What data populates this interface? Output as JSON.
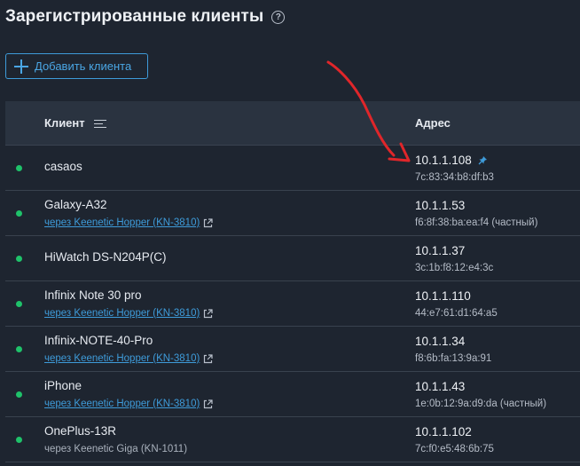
{
  "page": {
    "title": "Зарегистрированные клиенты",
    "help_icon": "?",
    "add_button_label": "Добавить клиента"
  },
  "table": {
    "headers": {
      "client": "Клиент",
      "address": "Адрес"
    },
    "rows": [
      {
        "name": "casaos",
        "via": "",
        "via_link": false,
        "ip": "10.1.1.108",
        "mac": "7c:83:34:b8:df:b3",
        "pinned": true,
        "status": "online"
      },
      {
        "name": "Galaxy-A32",
        "via": "через Keenetic Hopper (KN-3810)",
        "via_link": true,
        "ip": "10.1.1.53",
        "mac": "f6:8f:38:ba:ea:f4 (частный)",
        "pinned": false,
        "status": "online"
      },
      {
        "name": "HiWatch DS-N204P(C)",
        "via": "",
        "via_link": false,
        "ip": "10.1.1.37",
        "mac": "3c:1b:f8:12:e4:3c",
        "pinned": false,
        "status": "online"
      },
      {
        "name": "Infinix Note 30 pro",
        "via": "через Keenetic Hopper (KN-3810)",
        "via_link": true,
        "ip": "10.1.1.110",
        "mac": "44:e7:61:d1:64:a5",
        "pinned": false,
        "status": "online"
      },
      {
        "name": "Infinix-NOTE-40-Pro",
        "via": "через Keenetic Hopper (KN-3810)",
        "via_link": true,
        "ip": "10.1.1.34",
        "mac": "f8:6b:fa:13:9a:91",
        "pinned": false,
        "status": "online"
      },
      {
        "name": "iPhone",
        "via": "через Keenetic Hopper (KN-3810)",
        "via_link": true,
        "ip": "10.1.1.43",
        "mac": "1e:0b:12:9a:d9:da (частный)",
        "pinned": false,
        "status": "online"
      },
      {
        "name": "OnePlus-13R",
        "via": "через Keenetic Giga (KN-1011)",
        "via_link": false,
        "ip": "10.1.1.102",
        "mac": "7c:f0:e5:48:6b:75",
        "pinned": false,
        "status": "online"
      }
    ]
  },
  "colors": {
    "background": "#1e2530",
    "header_bg": "#2a3340",
    "accent": "#3e9bd9",
    "online": "#1fc26a",
    "annotation": "#e0262a"
  },
  "icons": [
    "help-icon",
    "plus-icon",
    "sort-icon",
    "external-link-icon",
    "pin-icon",
    "status-dot"
  ]
}
